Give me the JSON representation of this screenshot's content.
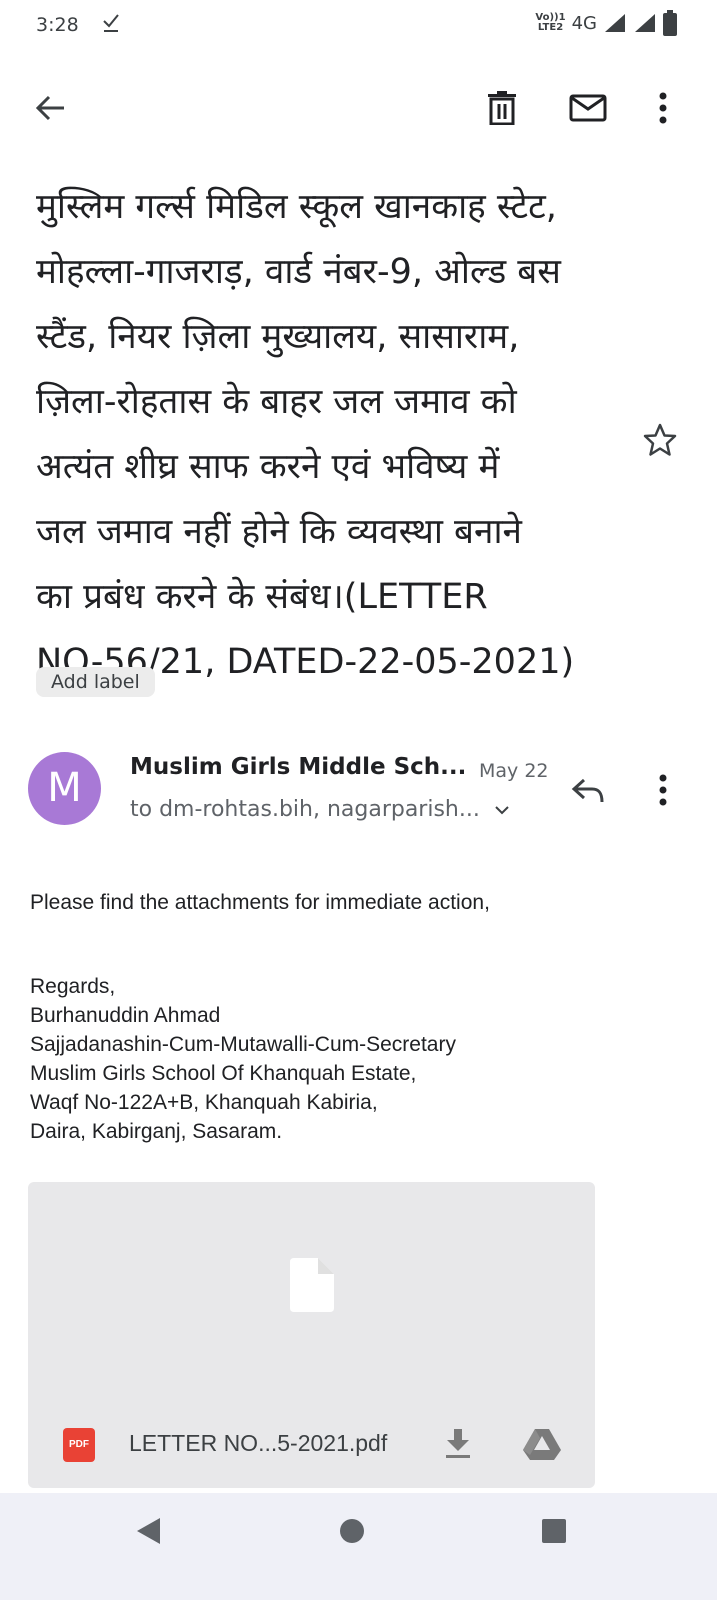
{
  "status_bar": {
    "time": "3:28",
    "volte_line1": "Vo))1",
    "volte_line2": "LTE2",
    "network": "4G"
  },
  "toolbar": {
    "back_icon": "arrow-left-icon",
    "delete_icon": "trash-icon",
    "mark_unread_icon": "mail-icon",
    "more_icon": "more-vert-icon"
  },
  "email": {
    "subject_lines": [
      "मुस्लिम गर्ल्स मिडिल स्कूल खानकाह स्टेट,",
      "मोहल्ला-गाजराड़, वार्ड नंबर-9,  ओल्ड बस",
      "स्टैंड, नियर ज़िला  मुख्यालय, सासाराम,",
      "ज़िला-रोहतास के बाहर जल जमाव को",
      "अत्यंत शीघ्र साफ करने एवं भविष्य में",
      "जल जमाव नहीं होने कि व्यवस्था बनाने",
      "का प्रबंध करने के संबंध।(LETTER",
      "NO-56/21, DATED-22-05-2021)"
    ],
    "add_label": "Add label",
    "sender_initial": "M",
    "sender_name": "Muslim Girls Middle Sch...",
    "date": "May 22",
    "recipients": "to dm-rohtas.bih, nagarparish...",
    "body_first": "Please find the attachments for immediate action,",
    "body_signature": [
      "Regards,",
      "Burhanuddin Ahmad",
      "Sajjadanashin-Cum-Mutawalli-Cum-Secretary",
      "Muslim Girls School Of Khanquah Estate,",
      "Waqf No-122A+B, Khanquah Kabiria,",
      "Daira, Kabirganj, Sasaram."
    ]
  },
  "attachment": {
    "type_badge": "PDF",
    "file_name": "LETTER NO...5-2021.pdf"
  },
  "colors": {
    "avatar": "#a879d6",
    "pdf_badge": "#e94235",
    "attachment_bg": "#e8e8ea",
    "navbar_bg": "#eff0f7"
  }
}
